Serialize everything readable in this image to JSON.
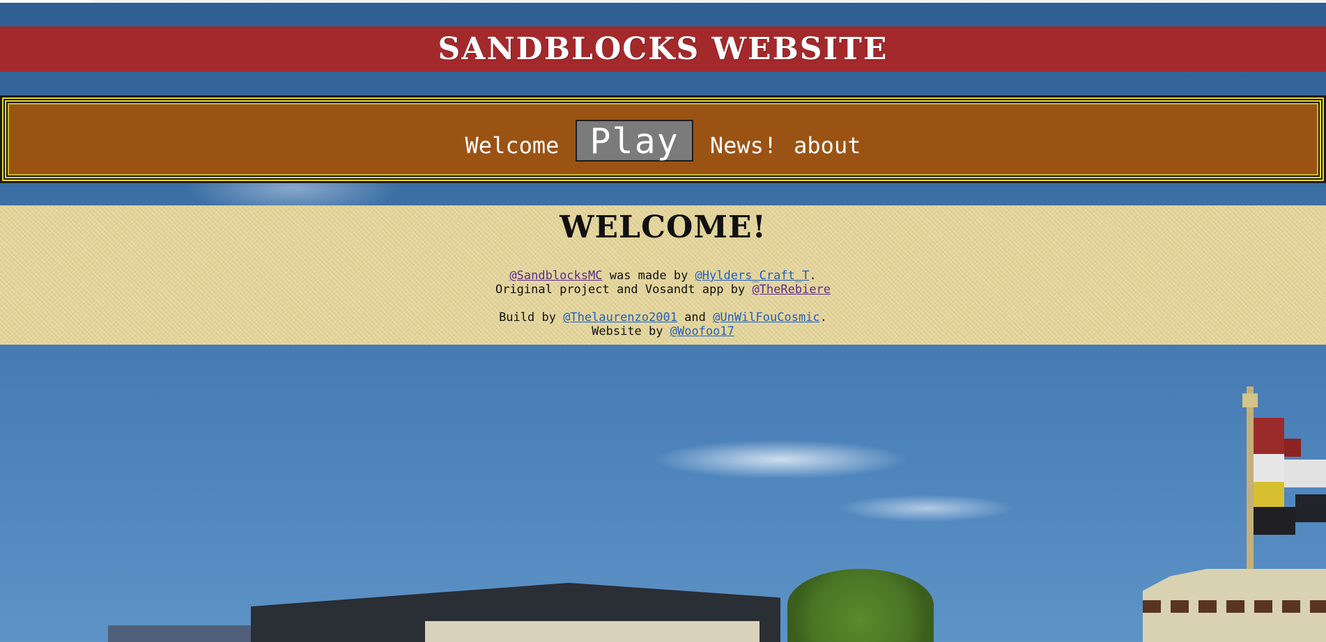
{
  "site": {
    "title": "SANDBLOCKS WEBSITE"
  },
  "nav": {
    "items": [
      {
        "label": "Welcome",
        "active": false
      },
      {
        "label": "Play",
        "active": true
      },
      {
        "label": "News!",
        "active": false
      },
      {
        "label": "about",
        "active": false
      }
    ]
  },
  "welcome": {
    "heading": "WELCOME!",
    "line1": {
      "link_a": "@SandblocksMC",
      "text_a": " was made by ",
      "link_b": "@Hylders_Craft_T",
      "text_end": "."
    },
    "line2": {
      "text_a": "Original project and Vosandt app by ",
      "link_a": "@TheRebiere"
    },
    "line3": {
      "text_a": "Build by ",
      "link_a": "@Thelaurenzo2001",
      "text_b": " and ",
      "link_b": "@UnWilFouCosmic",
      "text_end": "."
    },
    "line4": {
      "text_a": "Website by ",
      "link_a": "@Woofoo17"
    }
  },
  "colors": {
    "title_bar": "#a3292b",
    "nav_bg": "#9b5314",
    "nav_border": "#e6d63a",
    "welcome_bg": "#e4d59d",
    "visited_link": "#5a2a8c",
    "link": "#1f5fbf"
  }
}
